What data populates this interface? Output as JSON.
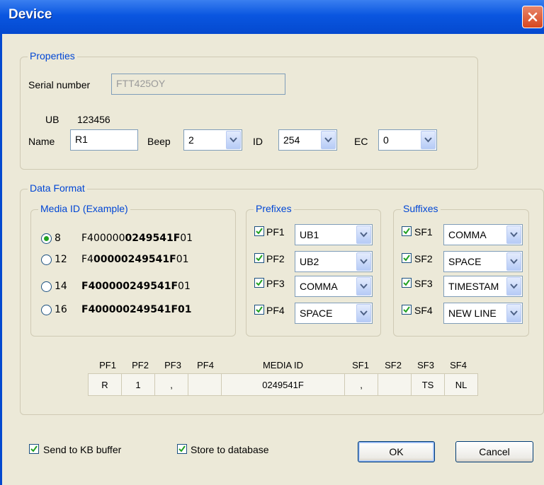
{
  "window": {
    "title": "Device"
  },
  "properties": {
    "legend": "Properties",
    "serial_label": "Serial number",
    "serial_value": "FTT425OY",
    "ub_label": "UB",
    "ub_value": "123456",
    "name_label": "Name",
    "name_value": "R1",
    "beep_label": "Beep",
    "beep_value": "2",
    "id_label": "ID",
    "id_value": "254",
    "ec_label": "EC",
    "ec_value": "0"
  },
  "data_format": {
    "legend": "Data Format",
    "media": {
      "legend": "Media ID (Example)",
      "options": [
        {
          "num": "8",
          "pre": "F400000",
          "bold": "0249541F",
          "post": "01",
          "selected": true
        },
        {
          "num": "12",
          "pre": "F4",
          "bold": "00000249541F",
          "post": "01",
          "selected": false
        },
        {
          "num": "14",
          "pre": "",
          "bold": "F400000249541F",
          "post": "01",
          "selected": false
        },
        {
          "num": "16",
          "pre": "",
          "bold": "F400000249541F01",
          "post": "",
          "selected": false
        }
      ]
    },
    "prefixes": {
      "legend": "Prefixes",
      "items": [
        {
          "label": "PF1",
          "value": "UB1",
          "checked": true
        },
        {
          "label": "PF2",
          "value": "UB2",
          "checked": true
        },
        {
          "label": "PF3",
          "value": "COMMA",
          "checked": true
        },
        {
          "label": "PF4",
          "value": "SPACE",
          "checked": true
        }
      ]
    },
    "suffixes": {
      "legend": "Suffixes",
      "items": [
        {
          "label": "SF1",
          "value": "COMMA",
          "checked": true
        },
        {
          "label": "SF2",
          "value": "SPACE",
          "checked": true
        },
        {
          "label": "SF3",
          "value": "TIMESTAM",
          "checked": true
        },
        {
          "label": "SF4",
          "value": "NEW LINE",
          "checked": true
        }
      ]
    },
    "preview": {
      "headers": [
        "PF1",
        "PF2",
        "PF3",
        "PF4",
        "MEDIA ID",
        "SF1",
        "SF2",
        "SF3",
        "SF4"
      ],
      "values": [
        "R",
        "1",
        ",",
        "",
        "0249541F",
        ",",
        "",
        "TS",
        "NL"
      ]
    }
  },
  "footer": {
    "send_kb_label": "Send to KB buffer",
    "send_kb_checked": true,
    "store_db_label": "Store to database",
    "store_db_checked": true,
    "ok_label": "OK",
    "cancel_label": "Cancel"
  },
  "colors": {
    "title_bar": "#0a56e0",
    "group_legend": "#0046d5",
    "face": "#ece9d8"
  }
}
